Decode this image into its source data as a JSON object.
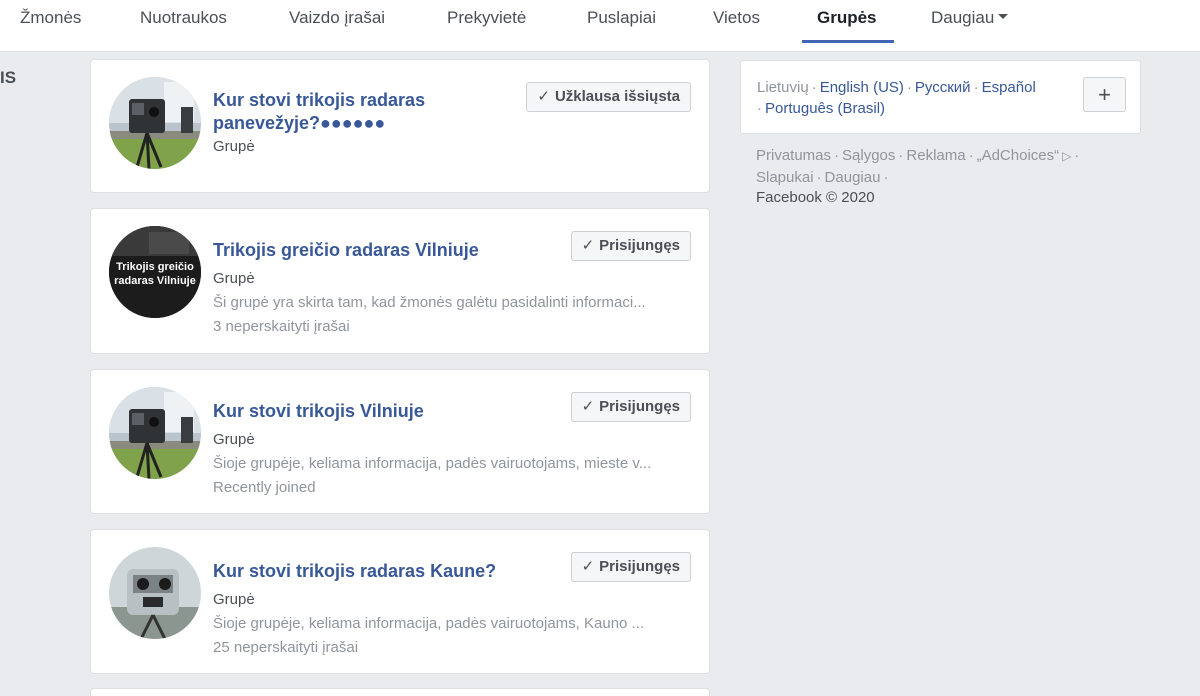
{
  "nav": {
    "items": [
      "Žmonės",
      "Nuotraukos",
      "Vaizdo įrašai",
      "Prekyvietė",
      "Puslapiai",
      "Vietos",
      "Grupės"
    ],
    "more_label": "Daugiau",
    "active": "Grupės"
  },
  "left_fragment": "IS",
  "groups": [
    {
      "title": "Kur stovi trikojis radaras panevežyje?●●●●●●",
      "type": "Grupė",
      "description": "",
      "meta": "",
      "button_label": "Užklausa išsiųsta",
      "avatar_icon": "radar-photo"
    },
    {
      "title": "Trikojis greičio radaras Vilniuje",
      "type": "Grupė",
      "description": "Ši grupė yra skirta tam, kad žmonės galėtu pasidalinti informaci...",
      "meta": "3 neperskaityti įrašai",
      "button_label": "Prisijungęs",
      "avatar_text": "Trikojis greičio radaras Vilniuje",
      "avatar_icon": "text-avatar"
    },
    {
      "title": "Kur stovi trikojis Vilniuje",
      "type": "Grupė",
      "description": "Šioje grupėje, keliama informacija, padės vairuotojams, mieste v...",
      "meta": "Recently joined",
      "button_label": "Prisijungęs",
      "avatar_icon": "radar-photo"
    },
    {
      "title": "Kur stovi trikojis radaras Kaune?",
      "type": "Grupė",
      "description": "Šioje grupėje, keliama informacija, padės vairuotojams, Kauno ...",
      "meta": "25 neperskaityti įrašai",
      "button_label": "Prisijungęs",
      "avatar_icon": "radar-closeup"
    }
  ],
  "languages": {
    "current": "Lietuvių",
    "links": [
      "English (US)",
      "Русский",
      "Español",
      "Português (Brasil)"
    ],
    "add_label": "+"
  },
  "footer": {
    "links": [
      "Privatumas",
      "Sąlygos",
      "Reklama",
      "„AdChoices“",
      "Slapukai",
      "Daugiau"
    ],
    "copyright": "Facebook © 2020"
  },
  "colors": {
    "link": "#385898",
    "accent": "#4267b2",
    "background": "#e9ebee"
  }
}
